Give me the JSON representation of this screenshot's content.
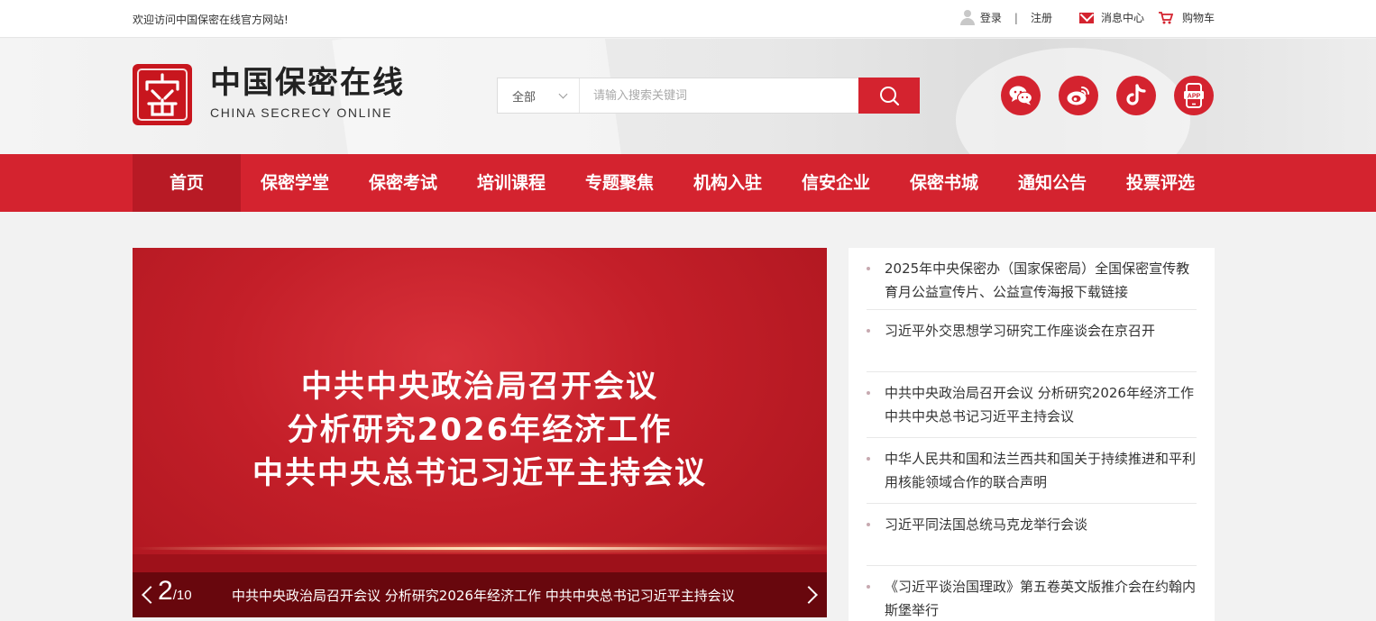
{
  "topbar": {
    "welcome": "欢迎访问中国保密在线官方网站!",
    "login": "登录",
    "separator": "|",
    "register": "注册",
    "messages": "消息中心",
    "cart": "购物车"
  },
  "logo": {
    "cn": "中国保密在线",
    "en": "CHINA SECRECY ONLINE"
  },
  "search": {
    "scope": "全部",
    "placeholder": "请输入搜索关键词"
  },
  "socials": [
    "wechat-icon",
    "weibo-icon",
    "douyin-icon",
    "app-icon"
  ],
  "nav": [
    "首页",
    "保密学堂",
    "保密考试",
    "培训课程",
    "专题聚焦",
    "机构入驻",
    "信安企业",
    "保密书城",
    "通知公告",
    "投票评选"
  ],
  "banner": {
    "title_lines": [
      "中共中央政治局召开会议",
      "分析研究2026年经济工作",
      "中共中央总书记习近平主持会议"
    ],
    "current": "2",
    "total": "/10",
    "caption": "中共中央政治局召开会议 分析研究2026年经济工作 中共中央总书记习近平主持会议"
  },
  "news": [
    "2025年中央保密办（国家保密局）全国保密宣传教育月公益宣传片、公益宣传海报下载链接",
    "习近平外交思想学习研究工作座谈会在京召开",
    "中共中央政治局召开会议 分析研究2026年经济工作 中共中央总书记习近平主持会议",
    "中华人民共和国和法兰西共和国关于持续推进和平利用核能领域合作的联合声明",
    "习近平同法国总统马克龙举行会谈",
    "《习近平谈治国理政》第五卷英文版推介会在约翰内斯堡举行"
  ],
  "colors": {
    "brand": "#d4232f",
    "nav_active": "#b81a25"
  }
}
